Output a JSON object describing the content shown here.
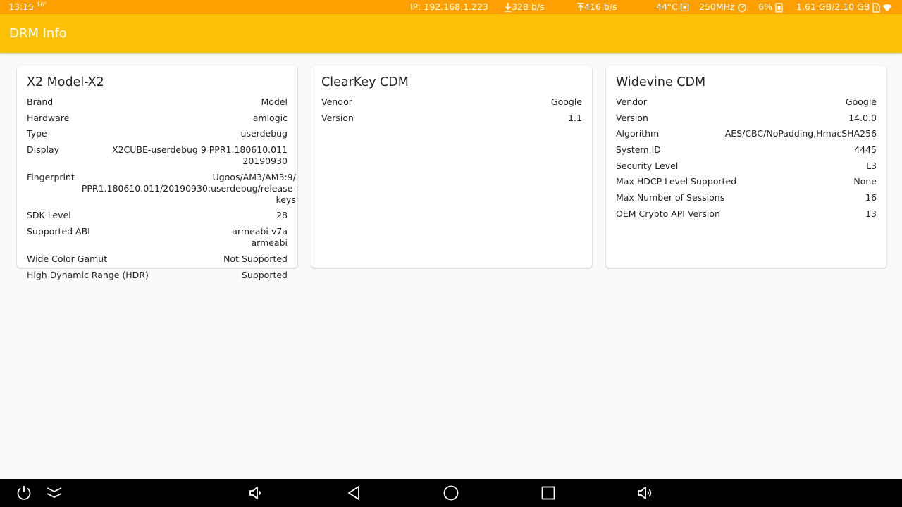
{
  "status_bar": {
    "time": "13:15",
    "temp_small": "16",
    "ip": "IP: 192.168.1.223",
    "download": "328 b/s",
    "upload": "416 b/s",
    "cpu_temp": "44°C",
    "cpu_freq": "250MHz",
    "cpu_usage": "6%",
    "memory": "1.61 GB/2.10 GB"
  },
  "app_bar": {
    "title": "DRM Info"
  },
  "cards": [
    {
      "title": "X2 Model-X2",
      "rows": [
        {
          "label": "Brand",
          "value": [
            "Model"
          ]
        },
        {
          "label": "Hardware",
          "value": [
            "amlogic"
          ]
        },
        {
          "label": "Type",
          "value": [
            "userdebug"
          ]
        },
        {
          "label": "Display",
          "value": [
            "X2CUBE-userdebug 9 PPR1.180610.011 20190930"
          ]
        },
        {
          "label": "Fingerprint",
          "value": [
            "Ugoos/AM3/AM3:9/",
            "PPR1.180610.011/20190930:userdebug/release-keys"
          ]
        },
        {
          "label": "SDK Level",
          "value": [
            "28"
          ]
        },
        {
          "label": "Supported ABI",
          "value": [
            "armeabi-v7a",
            "armeabi"
          ]
        },
        {
          "label": "Wide Color Gamut",
          "value": [
            "Not Supported"
          ]
        },
        {
          "label": "High Dynamic Range (HDR)",
          "value": [
            "Supported"
          ]
        }
      ]
    },
    {
      "title": "ClearKey CDM",
      "rows": [
        {
          "label": "Vendor",
          "value": [
            "Google"
          ]
        },
        {
          "label": "Version",
          "value": [
            "1.1"
          ]
        }
      ]
    },
    {
      "title": "Widevine CDM",
      "rows": [
        {
          "label": "Vendor",
          "value": [
            "Google"
          ]
        },
        {
          "label": "Version",
          "value": [
            "14.0.0"
          ]
        },
        {
          "label": "Algorithm",
          "value": [
            "AES/CBC/NoPadding,HmacSHA256"
          ]
        },
        {
          "label": "System ID",
          "value": [
            "4445"
          ]
        },
        {
          "label": "Security Level",
          "value": [
            "L3"
          ]
        },
        {
          "label": "Max HDCP Level Supported",
          "value": [
            "None"
          ]
        },
        {
          "label": "Max Number of Sessions",
          "value": [
            "16"
          ]
        },
        {
          "label": "OEM Crypto API Version",
          "value": [
            "13"
          ]
        }
      ]
    }
  ],
  "nav_bar": {
    "buttons": [
      {
        "name": "power-button",
        "icon": "power-icon"
      },
      {
        "name": "collapse-button",
        "icon": "chevron-double-down-icon"
      },
      {
        "name": "volume-down-button",
        "icon": "volume-down-icon"
      },
      {
        "name": "back-button",
        "icon": "back-triangle-icon"
      },
      {
        "name": "home-button",
        "icon": "home-circle-icon"
      },
      {
        "name": "recents-button",
        "icon": "recents-square-icon"
      },
      {
        "name": "volume-up-button",
        "icon": "volume-up-icon"
      }
    ]
  },
  "colors": {
    "status_bar": "#ffa000",
    "app_bar": "#ffc107",
    "background": "#fafafa",
    "nav_bar": "#000000"
  }
}
